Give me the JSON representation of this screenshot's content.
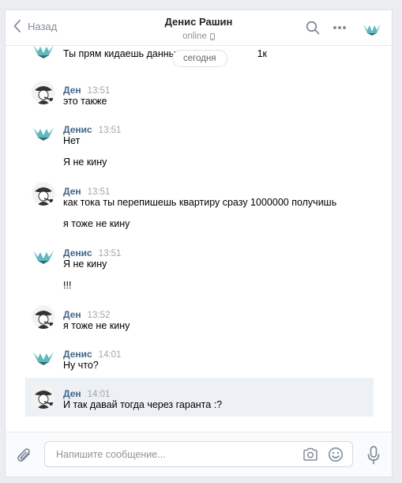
{
  "header": {
    "back_label": "Назад",
    "peer_name": "Денис Рашин",
    "peer_status": "online"
  },
  "date_pill": "сегодня",
  "messages": [
    {
      "author": "",
      "time": "",
      "lines": [
        "Ты прям кидаешь данные",
        "1к"
      ],
      "avatar": "denis"
    },
    {
      "author": "Ден",
      "time": "13:51",
      "lines": [
        "это также"
      ],
      "avatar": "den"
    },
    {
      "author": "Денис",
      "time": "13:51",
      "lines": [
        "Нет",
        "Я не кину"
      ],
      "avatar": "denis"
    },
    {
      "author": "Ден",
      "time": "13:51",
      "lines": [
        "как тока ты перепишешь квартиру сразу 1000000 получишь",
        "я тоже не кину"
      ],
      "avatar": "den"
    },
    {
      "author": "Денис",
      "time": "13:51",
      "lines": [
        "Я не кину",
        "!!!"
      ],
      "avatar": "denis"
    },
    {
      "author": "Ден",
      "time": "13:52",
      "lines": [
        "я тоже не кину"
      ],
      "avatar": "den"
    },
    {
      "author": "Денис",
      "time": "14:01",
      "lines": [
        "Ну что?"
      ],
      "avatar": "denis"
    },
    {
      "author": "Ден",
      "time": "14:01",
      "lines": [
        "И так давай тогда через гаранта :?"
      ],
      "avatar": "den",
      "selected": true
    }
  ],
  "composer": {
    "placeholder": "Напишите сообщение..."
  },
  "colors": {
    "accent": "#42648b",
    "muted": "#818c99",
    "selected_bg": "#edf0f5"
  },
  "icons": [
    "chevron-left-icon",
    "phone-icon",
    "search-icon",
    "more-icon",
    "peer-avatar-icon",
    "paperclip-icon",
    "camera-icon",
    "smile-icon",
    "microphone-icon"
  ]
}
